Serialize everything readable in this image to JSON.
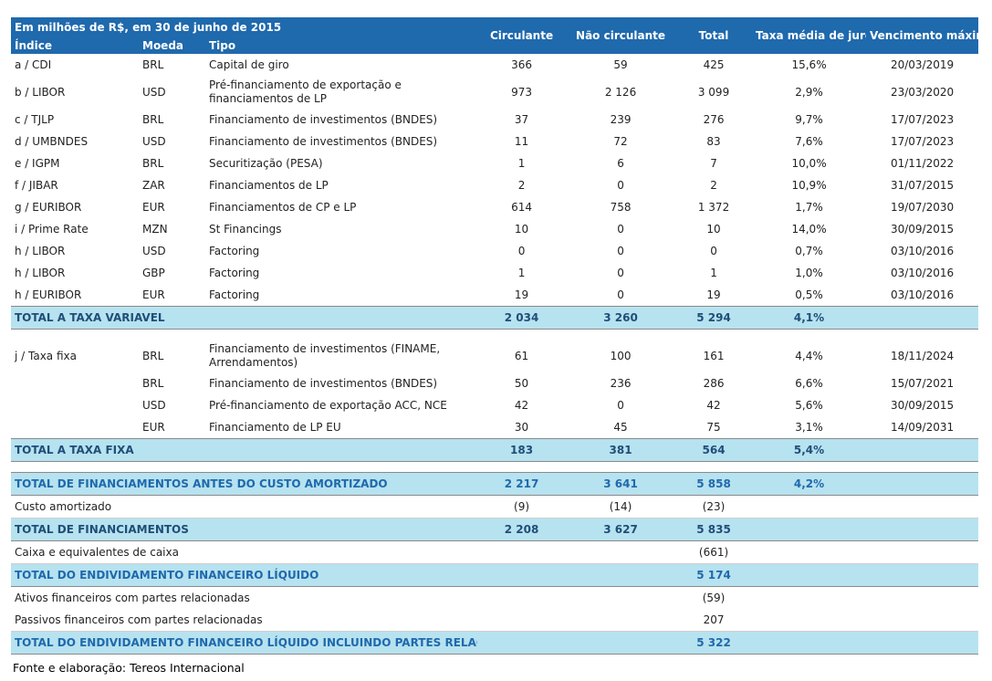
{
  "header": {
    "caption": "Em milhões de R$, em 30 de junho de 2015",
    "columns": [
      "Índice",
      "Moeda",
      "Tipo",
      "Circulante",
      "Não circulante",
      "Total",
      "Taxa média de juros",
      "Vencimento máximo"
    ]
  },
  "variable_rows": [
    {
      "indice": "a / CDI",
      "moeda": "BRL",
      "tipo": "Capital de giro",
      "circulante": "366",
      "nao_circulante": "59",
      "total": "425",
      "taxa": "15,6%",
      "vencimento": "20/03/2019"
    },
    {
      "indice": "b / LIBOR",
      "moeda": "USD",
      "tipo": "Pré-financiamento de exportação e financiamentos de LP",
      "circulante": "973",
      "nao_circulante": "2 126",
      "total": "3 099",
      "taxa": "2,9%",
      "vencimento": "23/03/2020"
    },
    {
      "indice": "c / TJLP",
      "moeda": "BRL",
      "tipo": "Financiamento de investimentos (BNDES)",
      "circulante": "37",
      "nao_circulante": "239",
      "total": "276",
      "taxa": "9,7%",
      "vencimento": "17/07/2023"
    },
    {
      "indice": "d / UMBNDES",
      "moeda": "USD",
      "tipo": "Financiamento de investimentos (BNDES)",
      "circulante": "11",
      "nao_circulante": "72",
      "total": "83",
      "taxa": "7,6%",
      "vencimento": "17/07/2023"
    },
    {
      "indice": "e / IGPM",
      "moeda": "BRL",
      "tipo": "Securitização (PESA)",
      "circulante": "1",
      "nao_circulante": "6",
      "total": "7",
      "taxa": "10,0%",
      "vencimento": "01/11/2022"
    },
    {
      "indice": "f / JIBAR",
      "moeda": "ZAR",
      "tipo": "Financiamentos de LP",
      "circulante": "2",
      "nao_circulante": "0",
      "total": "2",
      "taxa": "10,9%",
      "vencimento": "31/07/2015"
    },
    {
      "indice": "g / EURIBOR",
      "moeda": "EUR",
      "tipo": "Financiamentos de CP e LP",
      "circulante": "614",
      "nao_circulante": "758",
      "total": "1 372",
      "taxa": "1,7%",
      "vencimento": "19/07/2030"
    },
    {
      "indice": "i / Prime Rate",
      "moeda": "MZN",
      "tipo": "St Financings",
      "circulante": "10",
      "nao_circulante": "0",
      "total": "10",
      "taxa": "14,0%",
      "vencimento": "30/09/2015"
    },
    {
      "indice": "h / LIBOR",
      "moeda": "USD",
      "tipo": "Factoring",
      "circulante": "0",
      "nao_circulante": "0",
      "total": "0",
      "taxa": "0,7%",
      "vencimento": "03/10/2016"
    },
    {
      "indice": "h / LIBOR",
      "moeda": "GBP",
      "tipo": "Factoring",
      "circulante": "1",
      "nao_circulante": "0",
      "total": "1",
      "taxa": "1,0%",
      "vencimento": "03/10/2016"
    },
    {
      "indice": "h / EURIBOR",
      "moeda": "EUR",
      "tipo": "Factoring",
      "circulante": "19",
      "nao_circulante": "0",
      "total": "19",
      "taxa": "0,5%",
      "vencimento": "03/10/2016"
    }
  ],
  "total_variavel": {
    "label": "TOTAL A TAXA VARIAVEL",
    "circulante": "2 034",
    "nao_circulante": "3 260",
    "total": "5 294",
    "taxa": "4,1%"
  },
  "fixed_rows": [
    {
      "indice": "j / Taxa fixa",
      "moeda": "BRL",
      "tipo": "Financiamento de investimentos (FINAME, Arrendamentos)",
      "circulante": "61",
      "nao_circulante": "100",
      "total": "161",
      "taxa": "4,4%",
      "vencimento": "18/11/2024"
    },
    {
      "indice": "",
      "moeda": "BRL",
      "tipo": "Financiamento de investimentos (BNDES)",
      "circulante": "50",
      "nao_circulante": "236",
      "total": "286",
      "taxa": "6,6%",
      "vencimento": "15/07/2021"
    },
    {
      "indice": "",
      "moeda": "USD",
      "tipo": "Pré-financiamento de exportação ACC, NCE",
      "circulante": "42",
      "nao_circulante": "0",
      "total": "42",
      "taxa": "5,6%",
      "vencimento": "30/09/2015"
    },
    {
      "indice": "",
      "moeda": "EUR",
      "tipo": "Financiamento de LP EU",
      "circulante": "30",
      "nao_circulante": "45",
      "total": "75",
      "taxa": "3,1%",
      "vencimento": "14/09/2031"
    }
  ],
  "total_fixa": {
    "label": "TOTAL A TAXA FIXA",
    "circulante": "183",
    "nao_circulante": "381",
    "total": "564",
    "taxa": "5,4%"
  },
  "total_antes": {
    "label": "TOTAL DE FINANCIAMENTOS ANTES DO CUSTO AMORTIZADO",
    "circulante": "2 217",
    "nao_circulante": "3 641",
    "total": "5 858",
    "taxa": "4,2%"
  },
  "custo_amortizado": {
    "label": "Custo amortizado",
    "circulante": "(9)",
    "nao_circulante": "(14)",
    "total": "(23)"
  },
  "total_financiamentos": {
    "label": "TOTAL DE FINANCIAMENTOS",
    "circulante": "2 208",
    "nao_circulante": "3 627",
    "total": "5 835"
  },
  "caixa": {
    "label": "Caixa e equivalentes de caixa",
    "total": "(661)"
  },
  "total_liquido": {
    "label": "TOTAL DO ENDIVIDAMENTO FINANCEIRO LÍQUIDO",
    "total": "5 174"
  },
  "ativos": {
    "label": "Ativos financeiros com partes relacionadas",
    "total": "(59)"
  },
  "passivos": {
    "label": "Passivos financeiros com partes relacionadas",
    "total": "207"
  },
  "total_final": {
    "label": "TOTAL DO ENDIVIDAMENTO FINANCEIRO LÍQUIDO INCLUINDO PARTES RELACIONADAS",
    "total": "5 322"
  },
  "footer": "Fonte e elaboração: Tereos Internacional",
  "colors": {
    "header_bg": "#1f69ad",
    "total_bg": "#b7e2ef",
    "total_text": "#1f4e79"
  }
}
